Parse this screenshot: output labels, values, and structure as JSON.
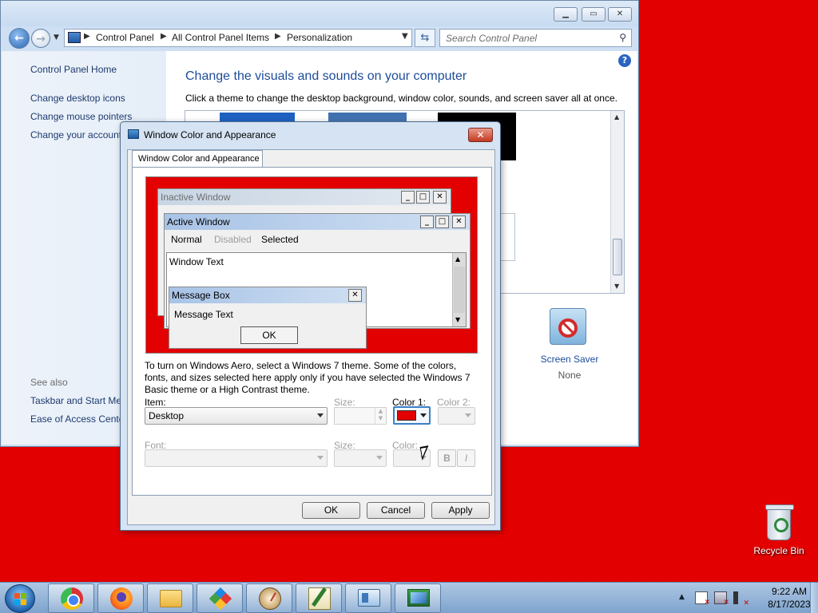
{
  "control_panel": {
    "breadcrumb": [
      "Control Panel",
      "All Control Panel Items",
      "Personalization"
    ],
    "search_placeholder": "Search Control Panel",
    "left_links": [
      "Control Panel Home",
      "Change desktop icons",
      "Change mouse pointers",
      "Change your account picture"
    ],
    "see_also_label": "See also",
    "see_also_links": [
      "Taskbar and Start Menu",
      "Ease of Access Center"
    ],
    "heading": "Change the visuals and sounds on your computer",
    "subheading": "Click a theme to change the desktop background, window color, sounds, and screen saver all at once.",
    "screen_saver_label": "Screen Saver",
    "screen_saver_value": "None"
  },
  "dialog": {
    "title": "Window Color and Appearance",
    "tab_label": "Window Color and Appearance",
    "preview": {
      "inactive_title": "Inactive Window",
      "active_title": "Active Window",
      "menu": [
        "Normal",
        "Disabled",
        "Selected"
      ],
      "window_text": "Window Text",
      "message_box_title": "Message Box",
      "message_text": "Message Text",
      "message_ok": "OK"
    },
    "info_text": "To turn on Windows Aero, select a Windows 7 theme.  Some of the colors, fonts, and sizes selected here apply only if you have selected the Windows 7 Basic theme or a High Contrast theme.",
    "item_label": "Item:",
    "item_value": "Desktop",
    "size_label": "Size:",
    "color1_label": "Color 1:",
    "color1_value": "#e30000",
    "color2_label": "Color 2:",
    "font_label": "Font:",
    "font_size_label": "Size:",
    "font_color_label": "Color:",
    "bold_label": "B",
    "italic_label": "I",
    "ok_label": "OK",
    "cancel_label": "Cancel",
    "apply_label": "Apply"
  },
  "desktop": {
    "background_color": "#e30000",
    "recycle_bin_label": "Recycle Bin"
  },
  "taskbar": {
    "pinned": [
      "chrome-icon",
      "firefox-icon",
      "file-explorer-icon",
      "gems-app-icon",
      "gauge-app-icon",
      "edit-app-icon",
      "control-panel-icon",
      "personalization-icon"
    ],
    "clock_time": "9:22 AM",
    "clock_date": "8/17/2023"
  }
}
